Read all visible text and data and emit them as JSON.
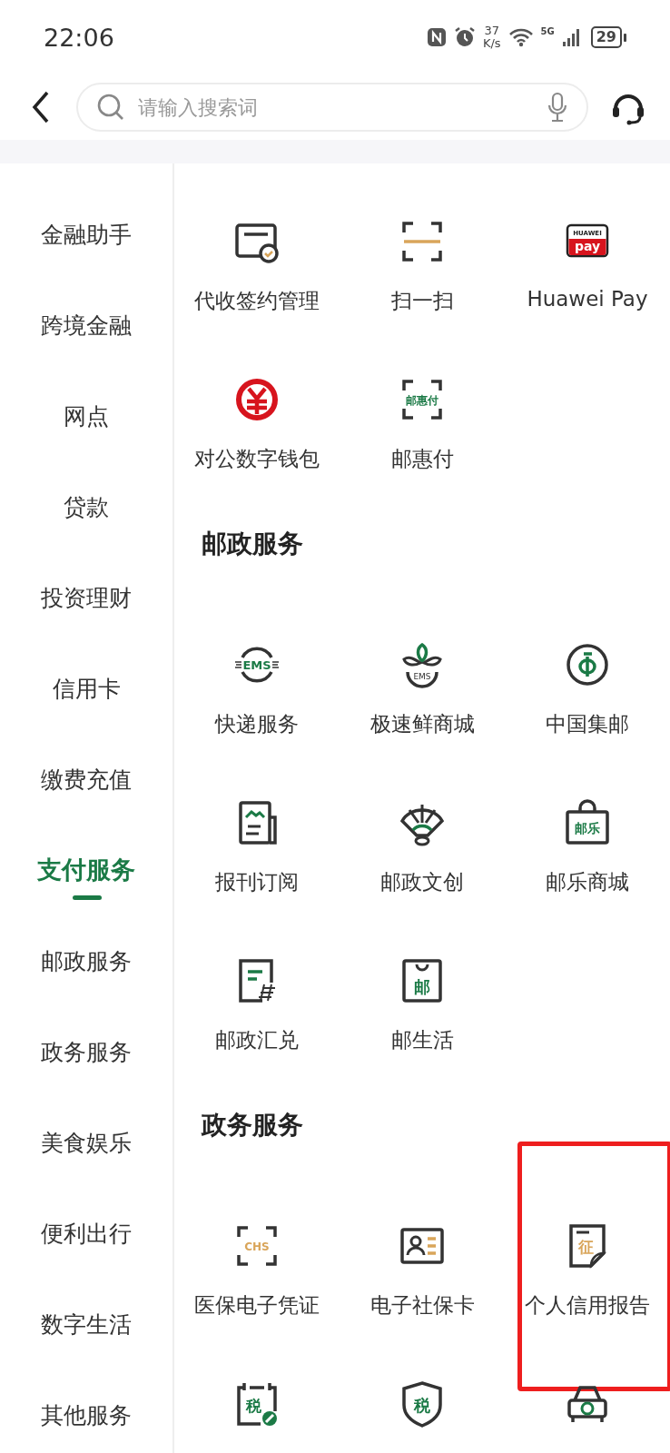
{
  "status_bar": {
    "time": "22:06",
    "speed": "37",
    "speed_unit": "K/s",
    "network": "5G",
    "battery": "29"
  },
  "search": {
    "placeholder": "请输入搜索词"
  },
  "sidebar": {
    "items": [
      {
        "label": "金融助手",
        "selected": false
      },
      {
        "label": "跨境金融",
        "selected": false
      },
      {
        "label": "网点",
        "selected": false
      },
      {
        "label": "贷款",
        "selected": false
      },
      {
        "label": "投资理财",
        "selected": false
      },
      {
        "label": "信用卡",
        "selected": false
      },
      {
        "label": "缴费充值",
        "selected": false
      },
      {
        "label": "支付服务",
        "selected": true
      },
      {
        "label": "邮政服务",
        "selected": false
      },
      {
        "label": "政务服务",
        "selected": false
      },
      {
        "label": "美食娱乐",
        "selected": false
      },
      {
        "label": "便利出行",
        "selected": false
      },
      {
        "label": "数字生活",
        "selected": false
      },
      {
        "label": "其他服务",
        "selected": false
      }
    ]
  },
  "sections": [
    {
      "items": [
        {
          "kind": "card-check",
          "label": "代收签约管理"
        },
        {
          "kind": "scan",
          "label": "扫一扫"
        },
        {
          "kind": "pay-badge",
          "icon_texts": [
            "HUAWEI",
            "pay"
          ],
          "label": "Huawei Pay"
        },
        {
          "kind": "yuan",
          "label": "对公数字钱包"
        },
        {
          "kind": "scan-text",
          "icon_texts": [
            "邮惠付"
          ],
          "label": "邮惠付"
        }
      ]
    },
    {
      "title": "邮政服务",
      "items": [
        {
          "kind": "ems",
          "icon_texts": [
            "EMS"
          ],
          "label": "快递服务"
        },
        {
          "kind": "flower",
          "icon_texts": [
            "EMS"
          ],
          "label": "极速鲜商城"
        },
        {
          "kind": "stamp",
          "label": "中国集邮"
        },
        {
          "kind": "newspaper",
          "label": "报刊订阅"
        },
        {
          "kind": "fan",
          "label": "邮政文创"
        },
        {
          "kind": "bag",
          "icon_texts": [
            "邮乐"
          ],
          "label": "邮乐商城"
        },
        {
          "kind": "transfer",
          "label": "邮政汇兑"
        },
        {
          "kind": "shopping-bag",
          "icon_texts": [
            "邮"
          ],
          "label": "邮生活"
        }
      ]
    },
    {
      "title": "政务服务",
      "items": [
        {
          "kind": "scan-text",
          "icon_texts": [
            "CHS"
          ],
          "label": "医保电子凭证"
        },
        {
          "kind": "id-card",
          "label": "电子社保卡"
        },
        {
          "kind": "document",
          "icon_texts": [
            "征"
          ],
          "label": "个人信用报告",
          "highlighted": true
        },
        {
          "kind": "calendar",
          "icon_texts": [
            "税"
          ]
        },
        {
          "kind": "shield",
          "icon_texts": [
            "税"
          ]
        },
        {
          "kind": "car"
        }
      ]
    }
  ]
}
